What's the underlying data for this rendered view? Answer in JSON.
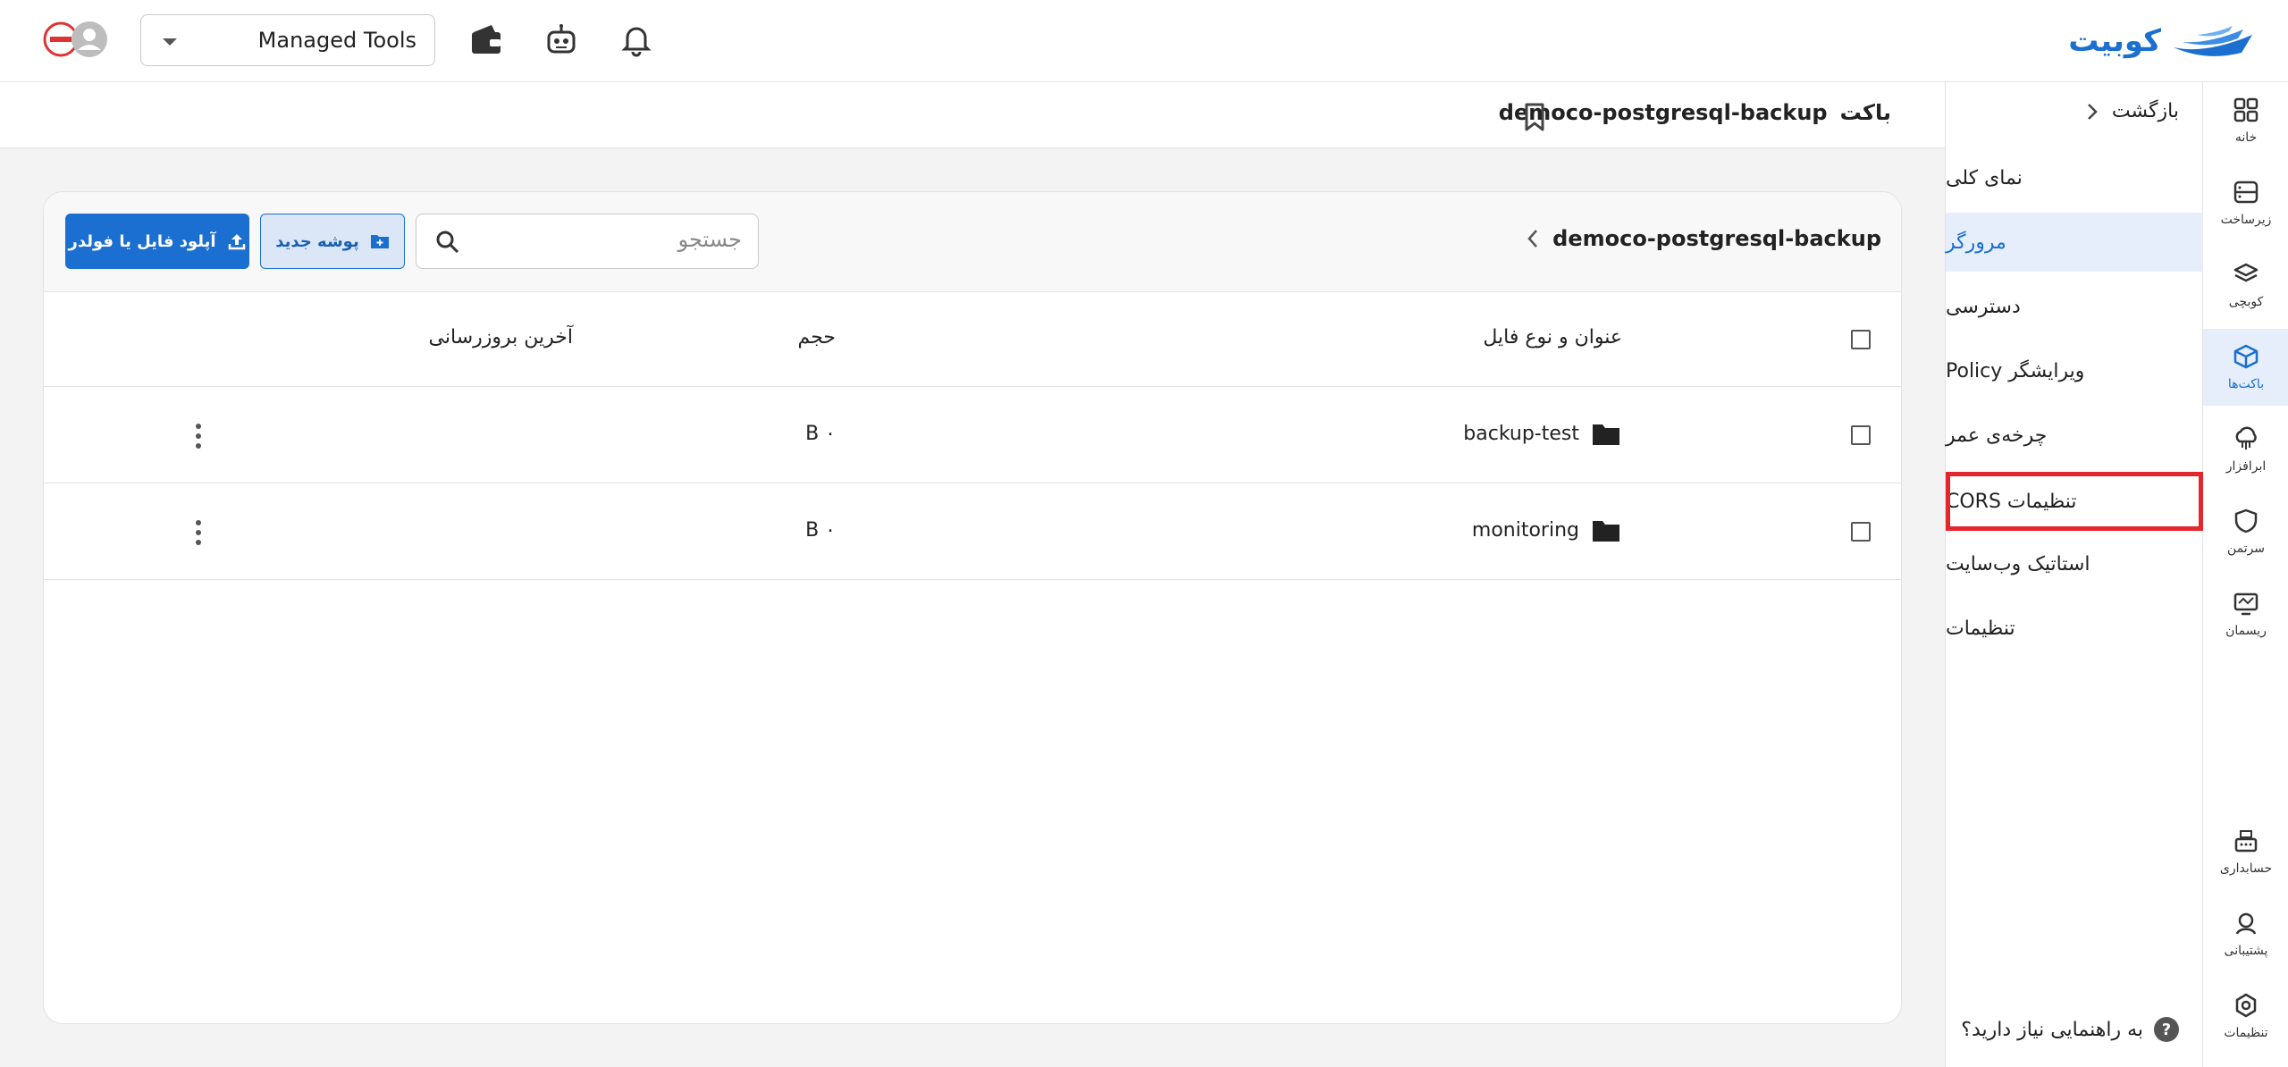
{
  "brand": {
    "name": "کوبیت"
  },
  "topbar": {
    "workspace_select": "Managed Tools"
  },
  "subheader": {
    "prefix": "باکت",
    "bucket": "democo-postgresql-backup"
  },
  "rail": [
    {
      "label": "خانه",
      "icon": "grid-icon"
    },
    {
      "label": "زیرساخت",
      "icon": "server-icon"
    },
    {
      "label": "کوبچی",
      "icon": "layers-icon"
    },
    {
      "label": "باکت‌ها",
      "icon": "cube-icon"
    },
    {
      "label": "ابرافزار",
      "icon": "cloud-icon"
    },
    {
      "label": "سرتمن",
      "icon": "shield-icon"
    },
    {
      "label": "ریسمان",
      "icon": "monitor-icon"
    },
    {
      "label": "حسابداری",
      "icon": "cash-register-icon"
    },
    {
      "label": "پشتیبانی",
      "icon": "support-icon"
    },
    {
      "label": "تنظیمات",
      "icon": "settings-icon"
    }
  ],
  "subnav": {
    "back": "بازگشت",
    "items": [
      {
        "label": "نمای کلی"
      },
      {
        "label": "مرورگر"
      },
      {
        "label": "دسترسی"
      },
      {
        "label": "ویرایشگر Policy"
      },
      {
        "label": "چرخه‌ی عمر"
      },
      {
        "label": "تنظیمات CORS"
      },
      {
        "label": "استاتیک وب‌سایت"
      },
      {
        "label": "تنظیمات"
      }
    ],
    "help": "به راهنمایی نیاز دارید؟"
  },
  "browser": {
    "breadcrumb": "democo-postgresql-backup",
    "search_placeholder": "جستجو",
    "new_folder": "پوشه جدید",
    "upload": "آپلود فایل یا فولدر",
    "columns": {
      "name": "عنوان و نوع فایل",
      "size": "حجم",
      "updated": "آخرین بروزرسانی"
    },
    "rows": [
      {
        "name": "backup-test",
        "size": "۰ B"
      },
      {
        "name": "monitoring",
        "size": "۰ B"
      }
    ]
  }
}
